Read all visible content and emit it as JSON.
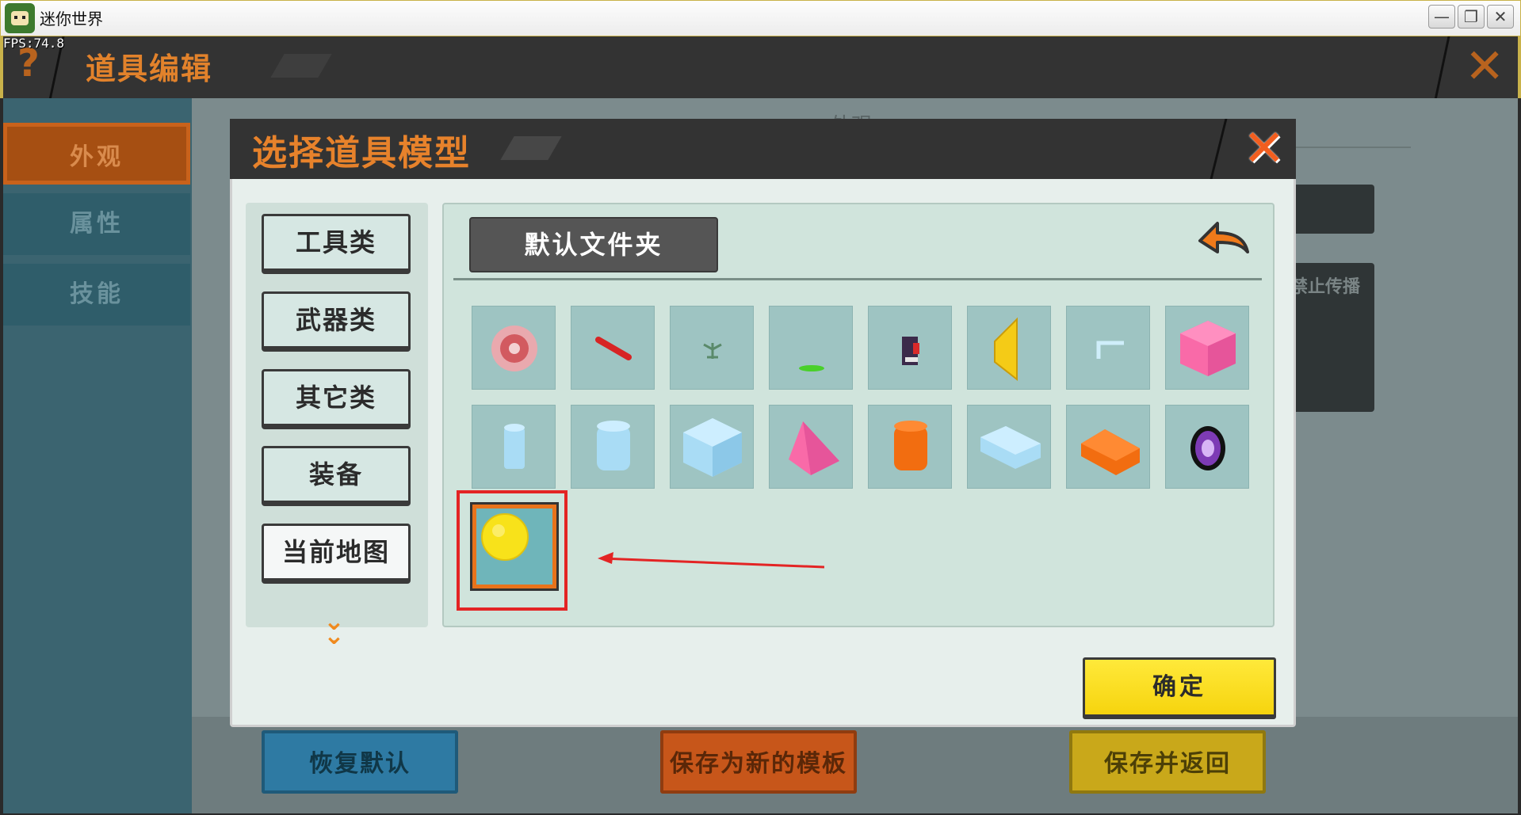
{
  "window": {
    "title": "迷你世界",
    "minimize": "—",
    "restore": "❐",
    "close": "✕"
  },
  "fps": "FPS:74.8",
  "header": {
    "help": "?",
    "title": "道具编辑",
    "close": "✕"
  },
  "sidebar": {
    "tabs": [
      {
        "label": "外观",
        "selected": true
      },
      {
        "label": "属性"
      },
      {
        "label": "技能"
      }
    ]
  },
  "background": {
    "heading": "外观",
    "side_text": "禁止传播"
  },
  "bottom": {
    "restore_default": "恢复默认",
    "save_as_template": "保存为新的模板",
    "save_and_return": "保存并返回"
  },
  "modal": {
    "title": "选择道具模型",
    "close": "✕",
    "categories": [
      "工具类",
      "武器类",
      "其它类",
      "装备",
      "当前地图"
    ],
    "selected_category": "当前地图",
    "folder": "默认文件夹",
    "confirm": "确定",
    "models": [
      "red-flower-block-icon",
      "red-stick-icon",
      "small-plant-icon",
      "green-disc-icon",
      "dark-figure-icon",
      "yellow-wedge-icon",
      "light-blue-pipe-icon",
      "pink-cube-icon",
      "blue-thin-cylinder-icon",
      "blue-cylinder-icon",
      "blue-cube-icon",
      "pink-slope-icon",
      "orange-cylinder-icon",
      "blue-slab-icon",
      "orange-beam-icon",
      "purple-disc-icon",
      "yellow-sphere-icon"
    ],
    "selected_model": "yellow-sphere-icon"
  },
  "colors": {
    "accent_orange": "#e7822b",
    "confirm_yellow": "#f6d40e",
    "annotation_red": "#e32424"
  }
}
